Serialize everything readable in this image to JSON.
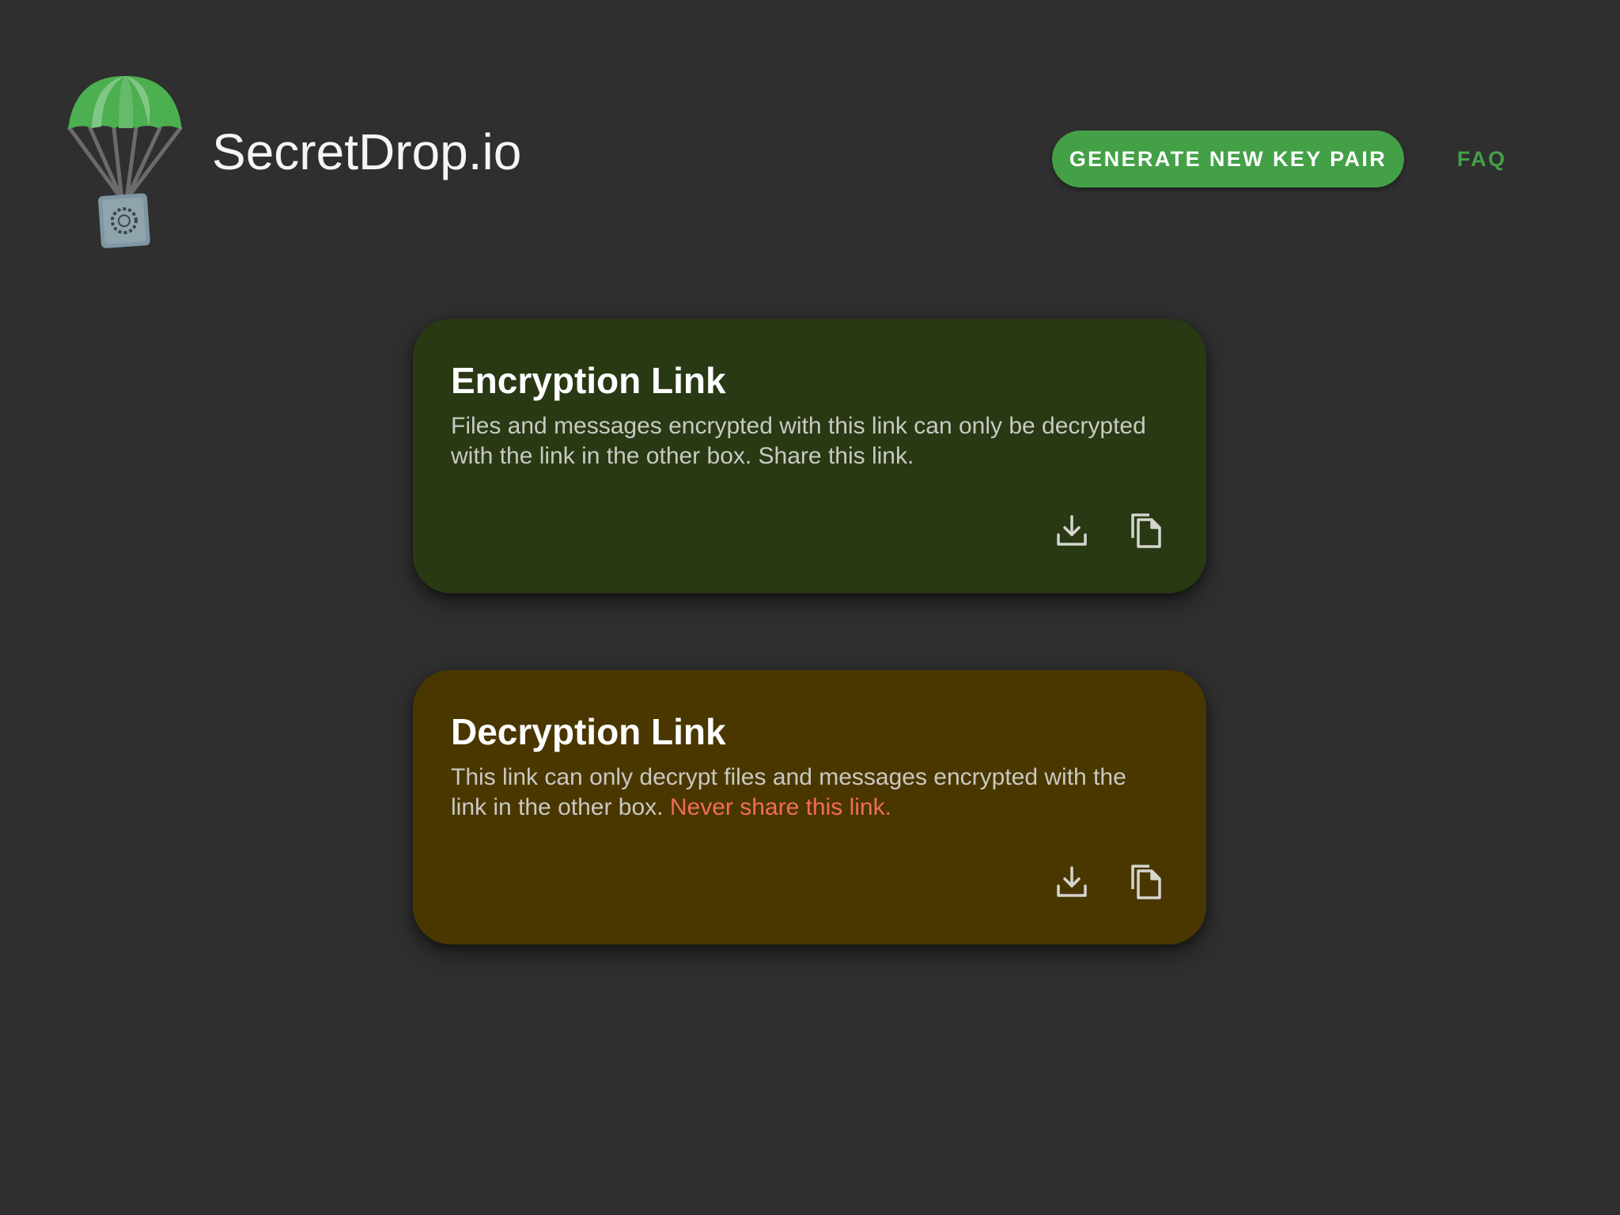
{
  "header": {
    "logo_icon": "parachute-safe-icon",
    "app_title": "SecretDrop.io",
    "generate_button_label": "GENERATE NEW KEY PAIR",
    "faq_label": "FAQ"
  },
  "cards": {
    "encryption": {
      "title": "Encryption Link",
      "description": "Files and messages encrypted with this link can only be decrypted with the link in the other box. Share this link.",
      "background": "#283913",
      "actions": [
        "download-icon",
        "copy-icon"
      ]
    },
    "decryption": {
      "title": "Decryption Link",
      "description": "This link can only decrypt files and messages encrypted with the link in the other box.",
      "warning": "Never share this link.",
      "background": "#4a3700",
      "warning_color": "#f26b5b",
      "actions": [
        "download-icon",
        "copy-icon"
      ]
    }
  },
  "colors": {
    "page_background": "#2f2f2f",
    "accent_green": "#43a047"
  }
}
